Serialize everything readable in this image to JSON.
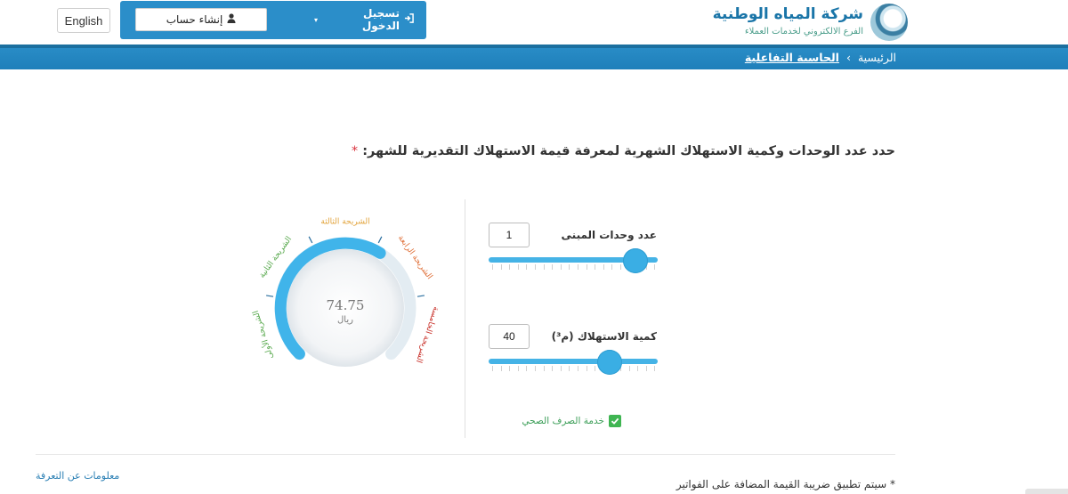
{
  "header": {
    "logo_name": "شركة المياه الوطنية",
    "logo_sub": "الفرع الالكتروني لخدمات العملاء",
    "login_label": "تسجيل الدخول",
    "register_label": "إنشاء حساب",
    "language_label": "English"
  },
  "breadcrumb": {
    "home": "الرئيسية",
    "separator": "›",
    "current": "الحاسبة التفاعلية"
  },
  "main": {
    "heading": "حدد عدد الوحدات وكمية الاستهلاك الشهرية لمعرفة قيمة الاستهلاك التقديرية للشهر:",
    "required_mark": "*",
    "units": {
      "label": "عدد وحدات المبنى",
      "value": "1",
      "slider_fraction": 0.93
    },
    "consumption": {
      "label": "كمية الاستهلاك (م³)",
      "value": "40",
      "slider_fraction": 0.75
    },
    "sewage": {
      "label": "خدمة الصرف الصحي",
      "checked": true
    }
  },
  "gauge": {
    "value": "74.75",
    "unit": "ريال",
    "bands": [
      "الشريحة الأولى",
      "الشريحة الثانية",
      "الشريحة الثالثة",
      "الشريحة الرابعة",
      "الشريحة الخامسة"
    ],
    "band_colors": [
      "#56a84b",
      "#56a84b",
      "#e2a33a",
      "#e0713a",
      "#c9342d"
    ],
    "fill_color": "#40b4ea",
    "fill_fraction": 0.62
  },
  "footer": {
    "note": "* سيتم تطبيق ضريبة القيمة المضافة على الفواتير",
    "tariff_link": "معلومات عن التعرفة"
  },
  "colors": {
    "brand_blue": "#2b8ec9",
    "accent_green": "#3fb552"
  }
}
